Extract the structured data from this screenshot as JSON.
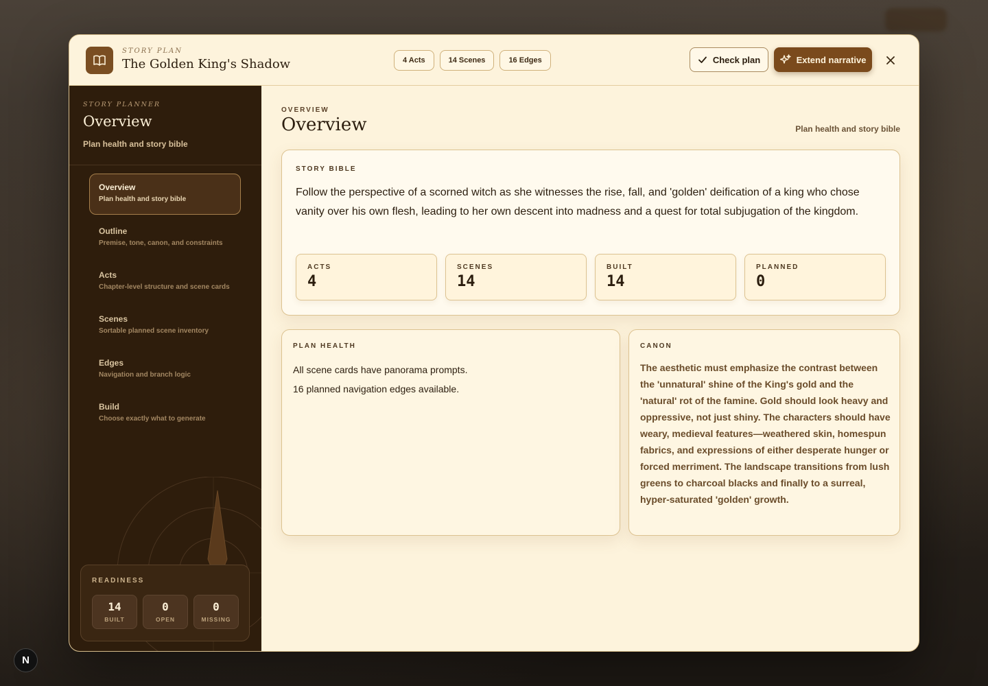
{
  "header": {
    "kicker": "STORY PLAN",
    "title": "The Golden King's Shadow",
    "chips": [
      "4 Acts",
      "14 Scenes",
      "16 Edges"
    ],
    "check_label": "Check plan",
    "extend_label": "Extend narrative"
  },
  "sidebar": {
    "kicker": "STORY PLANNER",
    "title": "Overview",
    "subtitle": "Plan health and story bible",
    "items": [
      {
        "label": "Overview",
        "desc": "Plan health and story bible"
      },
      {
        "label": "Outline",
        "desc": "Premise, tone, canon, and constraints"
      },
      {
        "label": "Acts",
        "desc": "Chapter-level structure and scene cards"
      },
      {
        "label": "Scenes",
        "desc": "Sortable planned scene inventory"
      },
      {
        "label": "Edges",
        "desc": "Navigation and branch logic"
      },
      {
        "label": "Build",
        "desc": "Choose exactly what to generate"
      }
    ],
    "readiness": {
      "label": "READINESS",
      "tiles": [
        {
          "value": "14",
          "caption": "BUILT"
        },
        {
          "value": "0",
          "caption": "OPEN"
        },
        {
          "value": "0",
          "caption": "MISSING"
        }
      ]
    }
  },
  "main": {
    "kicker": "OVERVIEW",
    "title": "Overview",
    "subtitle": "Plan health and story bible",
    "bible": {
      "label": "STORY BIBLE",
      "text": "Follow the perspective of a scorned witch as she witnesses the rise, fall, and 'golden' deification of a king who chose vanity over his own flesh, leading to her own descent into madness and a quest for total subjugation of the kingdom.",
      "stats": [
        {
          "label": "ACTS",
          "value": "4"
        },
        {
          "label": "SCENES",
          "value": "14"
        },
        {
          "label": "BUILT",
          "value": "14"
        },
        {
          "label": "PLANNED",
          "value": "0"
        }
      ]
    },
    "health": {
      "label": "PLAN HEALTH",
      "lines": [
        "All scene cards have panorama prompts.",
        "16 planned navigation edges available."
      ]
    },
    "canon": {
      "label": "CANON",
      "text": "The aesthetic must emphasize the contrast between the 'unnatural' shine of the King's gold and the 'natural' rot of the famine. Gold should look heavy and oppressive, not just shiny. The characters should have weary, medieval features—weathered skin, homespun fabrics, and expressions of either desperate hunger or forced merriment. The landscape transitions from lush greens to charcoal blacks and finally to a surreal, hyper-saturated 'golden' growth."
    }
  },
  "badge": "N",
  "icons": {
    "logo": "book-icon",
    "check": "checkmark-icon",
    "extend": "sparkles-icon",
    "close": "close-icon",
    "compass": "compass-icon"
  },
  "colors": {
    "accent": "#7a4a1c",
    "sidebar_bg": "#2e1d0c",
    "panel_bg": "#fdf3dc"
  }
}
